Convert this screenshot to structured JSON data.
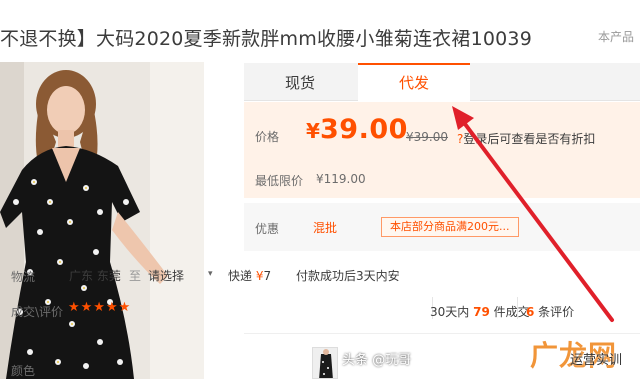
{
  "header": {
    "title": "不退不换】大码2020夏季新款胖mm收腰小雏菊连衣裙10039",
    "right_text": "本产品"
  },
  "tabs": [
    {
      "label": "现货",
      "active": false
    },
    {
      "label": "代发",
      "active": true
    }
  ],
  "price": {
    "label": "价格",
    "currency": "¥",
    "value": "39.00",
    "old_price": "¥39.00",
    "login_tip_icon": "?",
    "login_tip": "登录后可查看是否有折扣",
    "min_label": "最低限价",
    "min_value": "¥119.00"
  },
  "promo": {
    "label": "优惠",
    "tag": "混批",
    "coupon": "本店部分商品满200元..."
  },
  "shipping": {
    "label": "物流",
    "from": "广东 东莞",
    "to": "至",
    "select": "请选择",
    "caret": "▾",
    "fee_prefix": "快递 ",
    "fee_currency": "¥",
    "fee_value": "7",
    "note": "付款成功后3天内安"
  },
  "rating": {
    "label": "成交\\评价",
    "stars": "★★★★★",
    "sales_prefix": "30天内 ",
    "sales_count": "79",
    "sales_suffix": " 件成交",
    "review_count": "6",
    "review_suffix": " 条评价"
  },
  "color": {
    "label": "颜色"
  },
  "watermark": {
    "left": "头条 @玩哥",
    "logo": "广龙网",
    "right": "运营实训"
  },
  "colors": {
    "accent": "#ff5000",
    "arrow": "#e0202a",
    "price_bg": "#fff2e8"
  }
}
